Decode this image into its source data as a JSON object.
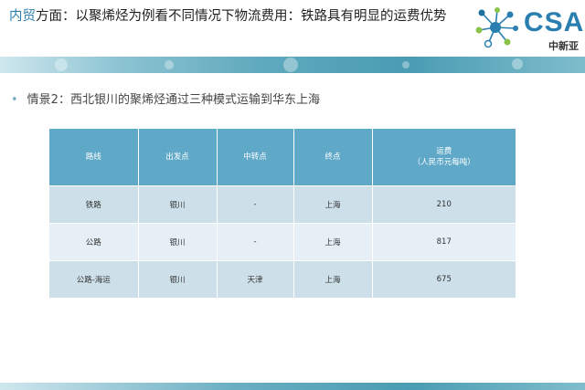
{
  "header": {
    "title_accent": "内贸",
    "title_rest": "方面：以聚烯烃为例看不同情况下物流费用：铁路具有明显的运费优势"
  },
  "logo": {
    "text": "CSA",
    "subtitle": "中新亚"
  },
  "content": {
    "bullet_icon": "bullet-dot",
    "scenario_text": "情景2：西北银川的聚烯烃通过三种模式运输到华东上海"
  },
  "table": {
    "headers": [
      "路线",
      "出发点",
      "中转点",
      "终点",
      "运费",
      "（人民币元每吨）"
    ],
    "rows": [
      [
        "铁路",
        "银川",
        "-",
        "上海",
        "210"
      ],
      [
        "公路",
        "银川",
        "-",
        "上海",
        "817"
      ],
      [
        "公路-海运",
        "银川",
        "天津",
        "上海",
        "675"
      ]
    ]
  },
  "colors": {
    "accent": "#2e7fb0",
    "header_bg": "#5fa8c7",
    "row_odd": "#cde0ea",
    "row_even": "#e6eff5"
  }
}
